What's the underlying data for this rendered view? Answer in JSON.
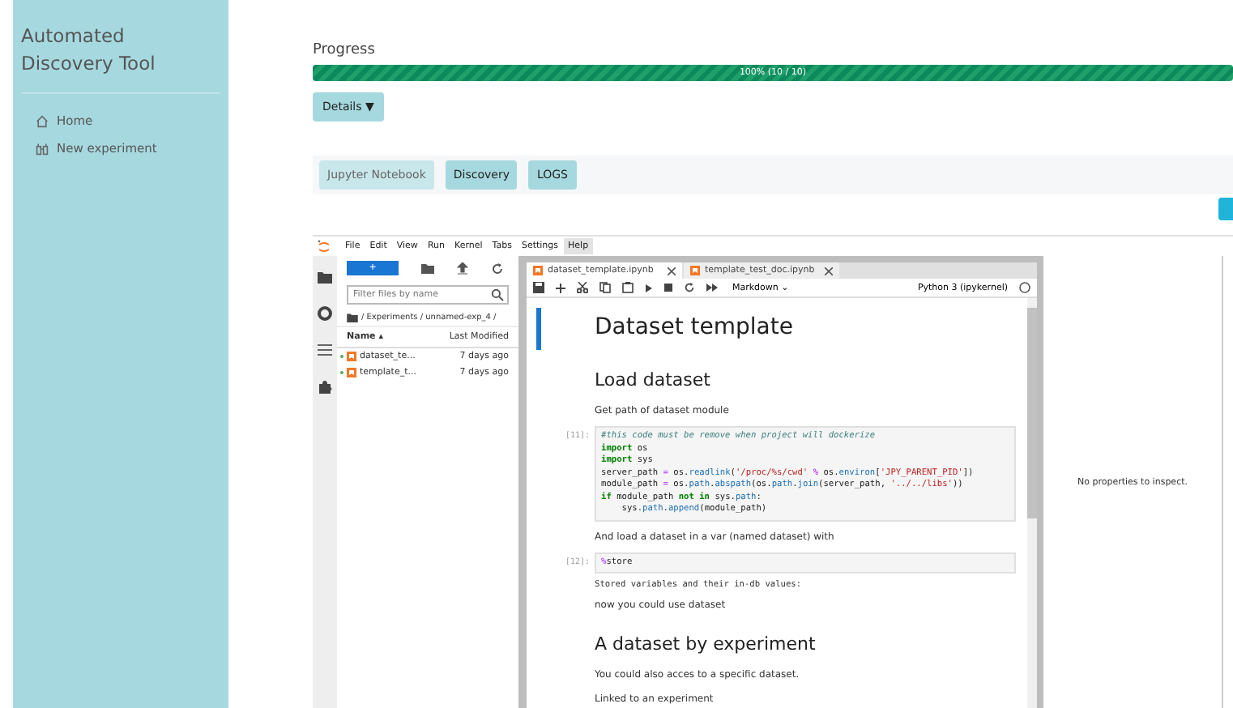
{
  "sidebar": {
    "title": "Automated Discovery Tool",
    "items": [
      {
        "label": "Home"
      },
      {
        "label": "New experiment"
      }
    ]
  },
  "progress": {
    "title": "Progress",
    "level": 1,
    "label": "100% (10 / 10)"
  },
  "details_button": {
    "label": "Details",
    "caret": "▼"
  },
  "tabs": [
    {
      "label": "Jupyter Notebook",
      "selected": true
    },
    {
      "label": "Discovery",
      "selected": false
    },
    {
      "label": "LOGS",
      "selected": false
    }
  ],
  "jupyter": {
    "menu": [
      {
        "label": "File",
        "selected": false
      },
      {
        "label": "Edit",
        "selected": false
      },
      {
        "label": "View",
        "selected": false
      },
      {
        "label": "Run",
        "selected": false
      },
      {
        "label": "Kernel",
        "selected": false
      },
      {
        "label": "Tabs",
        "selected": false
      },
      {
        "label": "Settings",
        "selected": false
      },
      {
        "label": "Help",
        "selected": true
      }
    ],
    "file_browser": {
      "new_button": "+",
      "filter_placeholder": "Filter files by name",
      "breadcrumb": "/ Experiments / unnamed-exp_4 /",
      "columns": [
        "Name",
        "Last Modified"
      ],
      "sort_indicator": "▴",
      "files": [
        {
          "name": "dataset_te...",
          "modified": "7 days ago",
          "running": true
        },
        {
          "name": "template_t...",
          "modified": "7 days ago",
          "running": true
        }
      ]
    },
    "doc_tabs": [
      {
        "label": "dataset_template.ipynb",
        "selected": true
      },
      {
        "label": "template_test_doc.ipynb",
        "selected": false
      }
    ],
    "cell_type": "Markdown",
    "cell_type_caret": "⌄",
    "kernel": "Python 3 (ipykernel)",
    "cells": [
      {
        "kind": "h1",
        "text": "Dataset template",
        "active": true
      },
      {
        "kind": "h2",
        "text": "Load dataset",
        "active": false
      },
      {
        "kind": "text",
        "text": "Get path of dataset module",
        "active": false
      },
      {
        "kind": "code",
        "prompt": "[11]:",
        "active": false,
        "lines": [
          [
            {
              "text": "#this code must be remove when project will dockerize",
              "kind": "comment"
            }
          ],
          [
            {
              "text": "import",
              "kind": "keyword"
            },
            {
              "text": " os",
              "kind": "plain"
            }
          ],
          [
            {
              "text": "import",
              "kind": "keyword"
            },
            {
              "text": " sys",
              "kind": "plain"
            }
          ],
          [
            {
              "text": "server_path ",
              "kind": "plain"
            },
            {
              "text": "=",
              "kind": "op"
            },
            {
              "text": " os.",
              "kind": "plain"
            },
            {
              "text": "readlink",
              "kind": "attr"
            },
            {
              "text": "(",
              "kind": "plain"
            },
            {
              "text": "'/proc/%s/cwd'",
              "kind": "string"
            },
            {
              "text": " % ",
              "kind": "op"
            },
            {
              "text": "os.",
              "kind": "plain"
            },
            {
              "text": "environ",
              "kind": "attr"
            },
            {
              "text": "[",
              "kind": "plain"
            },
            {
              "text": "'JPY_PARENT_PID'",
              "kind": "string"
            },
            {
              "text": "])",
              "kind": "plain"
            }
          ],
          [
            {
              "text": "module_path ",
              "kind": "plain"
            },
            {
              "text": "=",
              "kind": "op"
            },
            {
              "text": " os.",
              "kind": "plain"
            },
            {
              "text": "path",
              "kind": "attr"
            },
            {
              "text": ".",
              "kind": "plain"
            },
            {
              "text": "abspath",
              "kind": "attr"
            },
            {
              "text": "(os.",
              "kind": "plain"
            },
            {
              "text": "path",
              "kind": "attr"
            },
            {
              "text": ".",
              "kind": "plain"
            },
            {
              "text": "join",
              "kind": "attr"
            },
            {
              "text": "(server_path, ",
              "kind": "plain"
            },
            {
              "text": "'../../libs'",
              "kind": "string"
            },
            {
              "text": "))",
              "kind": "plain"
            }
          ],
          [
            {
              "text": "if",
              "kind": "keyword"
            },
            {
              "text": " module_path ",
              "kind": "plain"
            },
            {
              "text": "not in",
              "kind": "keyword"
            },
            {
              "text": " sys.",
              "kind": "plain"
            },
            {
              "text": "path",
              "kind": "attr"
            },
            {
              "text": ":",
              "kind": "plain"
            }
          ],
          [
            {
              "text": "    sys.",
              "kind": "plain"
            },
            {
              "text": "path",
              "kind": "attr"
            },
            {
              "text": ".",
              "kind": "plain"
            },
            {
              "text": "append",
              "kind": "attr"
            },
            {
              "text": "(module_path)",
              "kind": "plain"
            }
          ]
        ]
      },
      {
        "kind": "text",
        "text": "And load a dataset in a var (named dataset) with",
        "active": false
      },
      {
        "kind": "code",
        "prompt": "[12]:",
        "active": false,
        "lines": [
          [
            {
              "text": "%",
              "kind": "op"
            },
            {
              "text": "store",
              "kind": "plain"
            }
          ]
        ]
      },
      {
        "kind": "output",
        "text": "Stored variables and their in-db values:",
        "active": false
      },
      {
        "kind": "text",
        "text": "now you could use dataset",
        "active": false
      },
      {
        "kind": "h2",
        "text": "A dataset by experiment",
        "active": false
      },
      {
        "kind": "text",
        "text": "You could also acces to a specific dataset.",
        "active": false
      },
      {
        "kind": "text",
        "text": "Linked to an experiment",
        "active": false
      }
    ],
    "inspector": "No properties to inspect."
  }
}
